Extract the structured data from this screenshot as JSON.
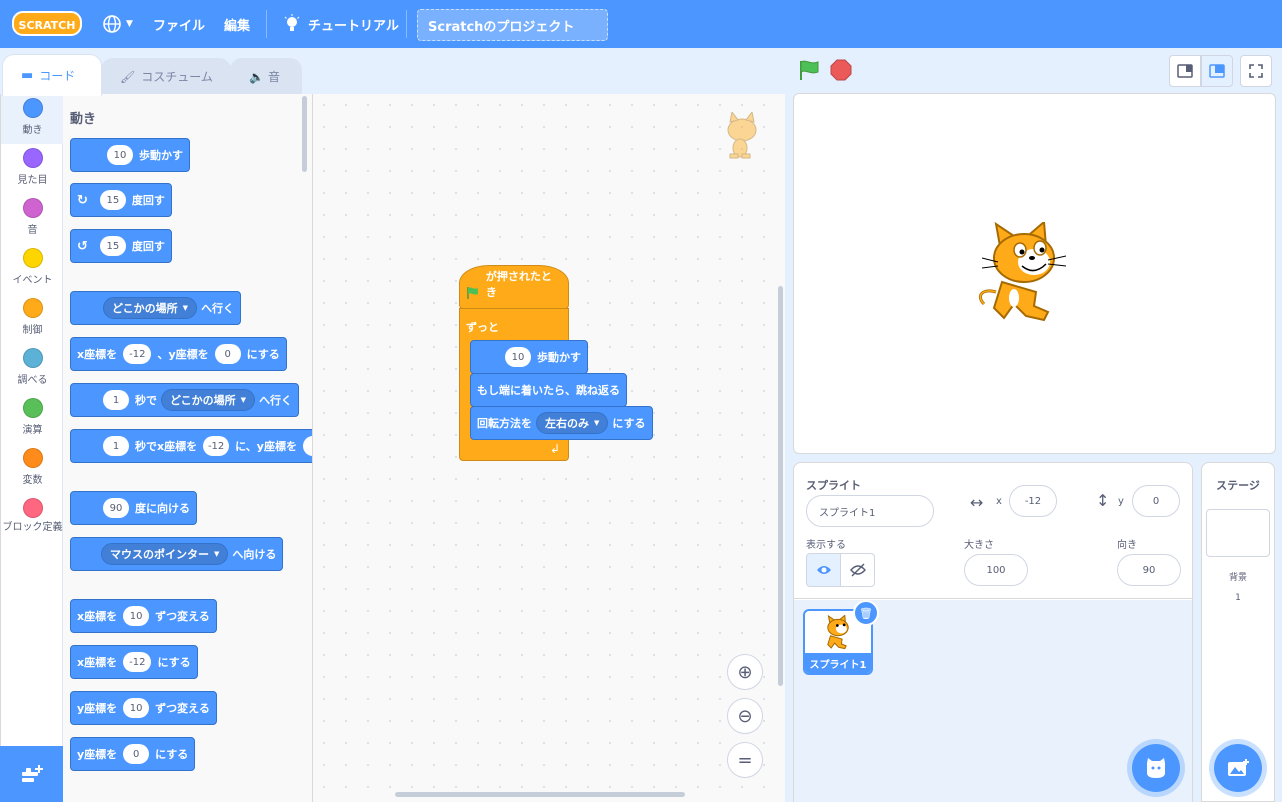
{
  "menubar": {
    "logo_text": "SCRATCH",
    "file": "ファイル",
    "edit": "編集",
    "tutorials": "チュートリアル",
    "project_title": "Scratchのプロジェクト"
  },
  "tabs": {
    "code": "コード",
    "costumes": "コスチューム",
    "sounds": "音"
  },
  "categories": [
    {
      "label": "動き",
      "color": "#4c97ff"
    },
    {
      "label": "見た目",
      "color": "#9966ff"
    },
    {
      "label": "音",
      "color": "#cf63cf"
    },
    {
      "label": "イベント",
      "color": "#ffd500"
    },
    {
      "label": "制御",
      "color": "#ffab19"
    },
    {
      "label": "調べる",
      "color": "#5cb1d6"
    },
    {
      "label": "演算",
      "color": "#59c059"
    },
    {
      "label": "変数",
      "color": "#ff8c1a"
    },
    {
      "label": "ブロック定義",
      "color": "#ff6680"
    }
  ],
  "palette": {
    "heading": "動き",
    "b1_num": "10",
    "b1_text": "歩動かす",
    "b2_num": "15",
    "b2_text": "度回す",
    "b3_num": "15",
    "b3_text": "度回す",
    "b4_dd": "どこかの場所",
    "b4_text": "へ行く",
    "b5_a": "x座標を",
    "b5_x": "-12",
    "b5_b": "、y座標を",
    "b5_y": "0",
    "b5_c": "にする",
    "b6_num": "1",
    "b6_a": "秒で",
    "b6_dd": "どこかの場所",
    "b6_b": "へ行く",
    "b7_num": "1",
    "b7_a": "秒でx座標を",
    "b7_x": "-12",
    "b7_b": "に、y座標を",
    "b8_num": "90",
    "b8_text": "度に向ける",
    "b9_dd": "マウスのポインター",
    "b9_text": "へ向ける",
    "b10_a": "x座標を",
    "b10_num": "10",
    "b10_b": "ずつ変える",
    "b11_a": "x座標を",
    "b11_num": "-12",
    "b11_b": "にする",
    "b12_a": "y座標を",
    "b12_num": "10",
    "b12_b": "ずつ変える",
    "b13_a": "y座標を",
    "b13_num": "0",
    "b13_b": "にする"
  },
  "script": {
    "hat": "が押されたとき",
    "forever": "ずっと",
    "move_num": "10",
    "move_text": "歩動かす",
    "bounce": "もし端に着いたら、跳ね返る",
    "rot_a": "回転方法を",
    "rot_dd": "左右のみ",
    "rot_b": "にする"
  },
  "sprite_info": {
    "heading": "スプライト",
    "name": "スプライト1",
    "x_label": "x",
    "x": "-12",
    "y_label": "y",
    "y": "0",
    "show_label": "表示する",
    "size_label": "大きさ",
    "size": "100",
    "direction_label": "向き",
    "direction": "90"
  },
  "sprites": [
    {
      "name": "スプライト1"
    }
  ],
  "stage_pane": {
    "heading": "ステージ",
    "backdrops_label": "背景",
    "backdrops_count": "1"
  },
  "colors": {
    "motion": "#4c97ff",
    "control": "#ffab19",
    "events": "#ffbf00",
    "menubar": "#4c97ff"
  }
}
